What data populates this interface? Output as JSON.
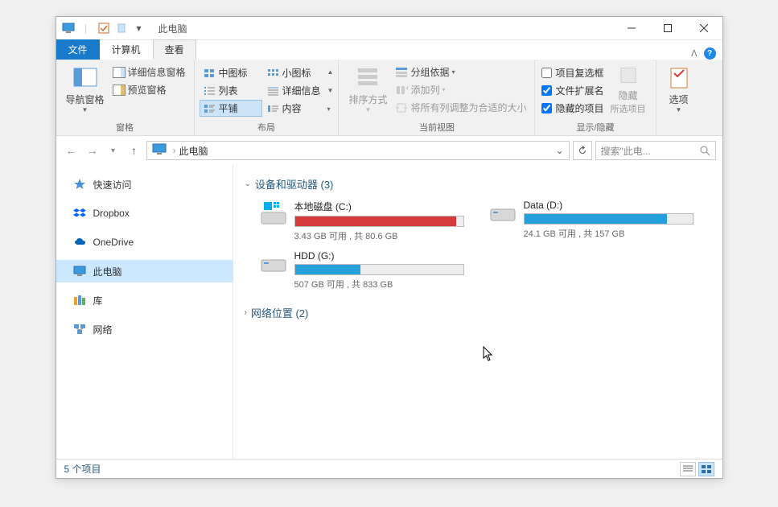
{
  "titlebar": {
    "title": "此电脑"
  },
  "tabs": {
    "file": "文件",
    "computer": "计算机",
    "view": "查看"
  },
  "ribbon": {
    "panes": {
      "group_label": "窗格",
      "nav_pane": "导航窗格",
      "preview_pane": "预览窗格",
      "details_pane": "详细信息窗格"
    },
    "layout": {
      "group_label": "布局",
      "medium_icons": "中图标",
      "small_icons": "小图标",
      "list": "列表",
      "details": "详细信息",
      "tiles": "平铺",
      "content": "内容"
    },
    "current_view": {
      "group_label": "当前视图",
      "sort": "排序方式",
      "group_by": "分组依据",
      "add_columns": "添加列",
      "fit_columns": "将所有列调整为合适的大小"
    },
    "show_hide": {
      "group_label": "显示/隐藏",
      "item_checkboxes": "项目复选框",
      "filename_ext": "文件扩展名",
      "hidden_items": "隐藏的项目",
      "hide_selected": "隐藏",
      "hide_selected_sub": "所选项目"
    },
    "options": {
      "label": "选项"
    }
  },
  "addressbar": {
    "location": "此电脑"
  },
  "searchbox": {
    "placeholder": "搜索\"此电..."
  },
  "sidebar": {
    "items": [
      {
        "label": "快速访问",
        "icon": "star"
      },
      {
        "label": "Dropbox",
        "icon": "dropbox"
      },
      {
        "label": "OneDrive",
        "icon": "onedrive"
      },
      {
        "label": "此电脑",
        "icon": "pc",
        "selected": true
      },
      {
        "label": "库",
        "icon": "library"
      },
      {
        "label": "网络",
        "icon": "network"
      }
    ]
  },
  "content": {
    "groups": [
      {
        "title": "设备和驱动器 (3)",
        "expanded": true,
        "drives": [
          {
            "name": "本地磁盘 (C:)",
            "status": "3.43 GB 可用 , 共 80.6 GB",
            "fill_percent": 96,
            "color": "red",
            "icon": "windisk"
          },
          {
            "name": "Data (D:)",
            "status": "24.1 GB 可用 , 共 157 GB",
            "fill_percent": 85,
            "color": "blue",
            "icon": "disk"
          },
          {
            "name": "HDD (G:)",
            "status": "507 GB 可用 , 共 833 GB",
            "fill_percent": 39,
            "color": "blue",
            "icon": "disk"
          }
        ]
      },
      {
        "title": "网络位置 (2)",
        "expanded": false
      }
    ]
  },
  "statusbar": {
    "text": "5 个项目"
  },
  "checkboxes": {
    "item_check": false,
    "ext": true,
    "hidden": true
  }
}
